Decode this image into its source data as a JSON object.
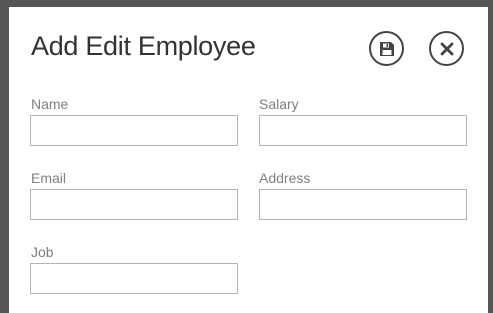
{
  "dialog": {
    "title": "Add Edit Employee",
    "save_icon": "save-icon",
    "close_icon": "close-icon"
  },
  "form": {
    "name": {
      "label": "Name",
      "value": "",
      "placeholder": ""
    },
    "salary": {
      "label": "Salary",
      "value": "",
      "placeholder": ""
    },
    "email": {
      "label": "Email",
      "value": "",
      "placeholder": ""
    },
    "address": {
      "label": "Address",
      "value": "",
      "placeholder": ""
    },
    "job": {
      "label": "Job",
      "value": "",
      "placeholder": ""
    }
  },
  "colors": {
    "backdrop": "#555555",
    "dialog_bg": "#ffffff",
    "title": "#333333",
    "label": "#808080",
    "input_border": "#b4b4b4",
    "icon": "#444444"
  }
}
